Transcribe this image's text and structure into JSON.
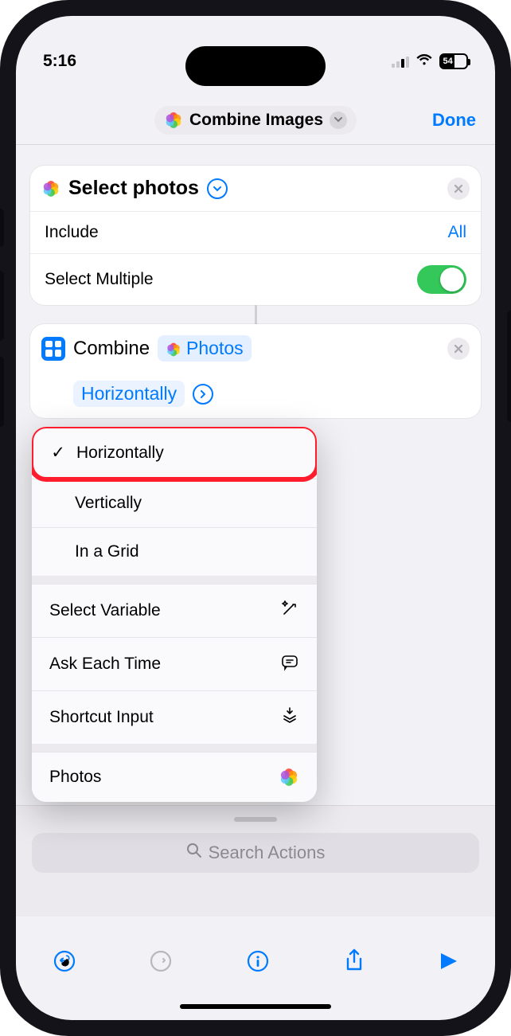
{
  "status": {
    "time": "5:16",
    "battery": "54"
  },
  "nav": {
    "title": "Combine Images",
    "done": "Done"
  },
  "action1": {
    "title": "Select photos",
    "include_label": "Include",
    "include_value": "All",
    "multi_label": "Select Multiple"
  },
  "action2": {
    "verb": "Combine",
    "token_photos": "Photos",
    "token_mode": "Horizontally"
  },
  "menu": {
    "sec1": [
      "Horizontally",
      "Vertically",
      "In a Grid"
    ],
    "sec2": [
      "Select Variable",
      "Ask Each Time",
      "Shortcut Input"
    ],
    "sec3": [
      "Photos"
    ],
    "selected_index": 0
  },
  "search": {
    "placeholder": "Search Actions"
  }
}
